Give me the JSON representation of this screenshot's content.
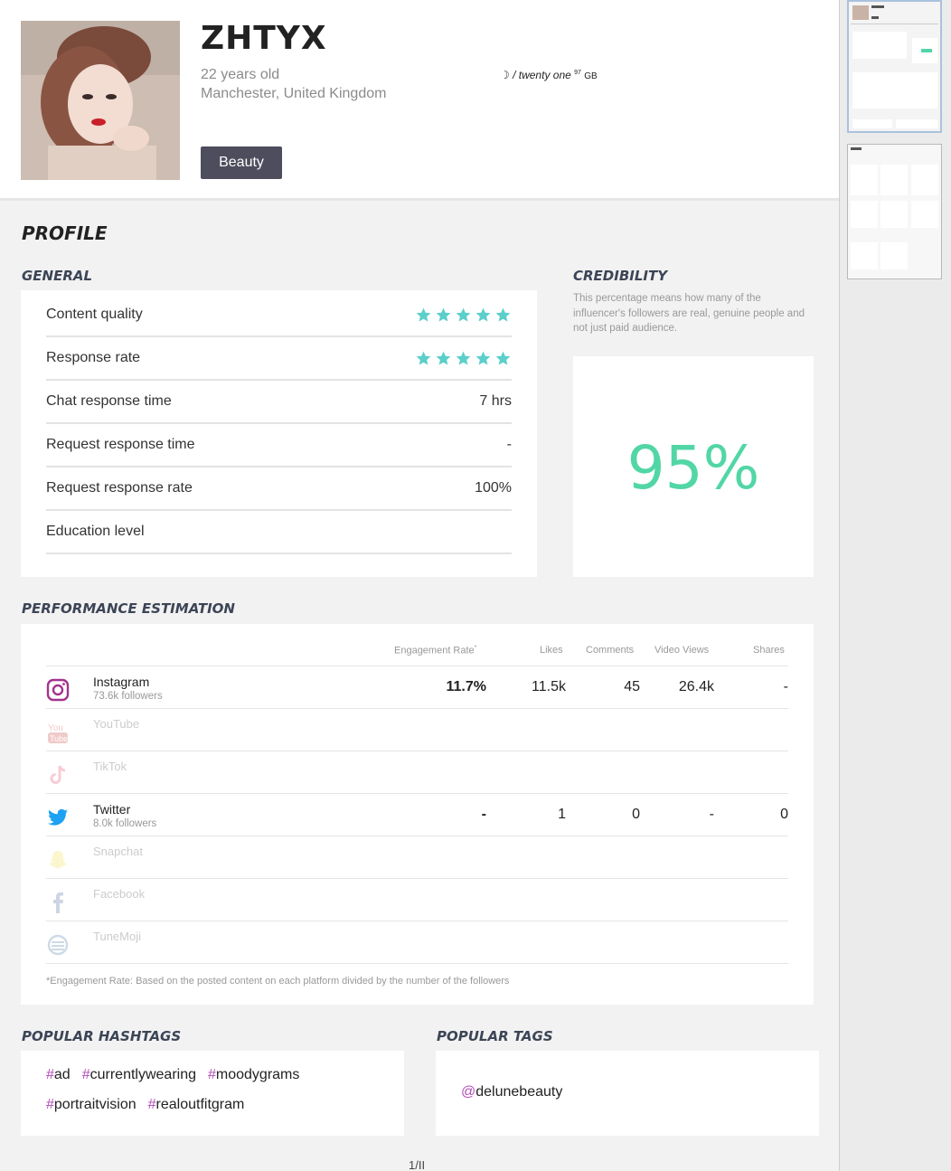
{
  "profile": {
    "name": "ZHTYX",
    "age": "22 years old",
    "location": "Manchester, United Kingdom",
    "source_brand": "☽ / twenty one",
    "source_sup": "97",
    "source_suffix": "GB",
    "category": "Beauty"
  },
  "sections": {
    "profile": "PROFILE",
    "general": "GENERAL",
    "credibility": "CREDIBILITY",
    "performance": "PERFORMANCE ESTIMATION",
    "hashtags": "POPULAR HASHTAGS",
    "tags": "POPULAR TAGS"
  },
  "general": [
    {
      "label": "Content quality",
      "stars": 5
    },
    {
      "label": "Response rate",
      "stars": 5
    },
    {
      "label": "Chat response time",
      "value": "7 hrs"
    },
    {
      "label": "Request response time",
      "value": "-"
    },
    {
      "label": "Request response rate",
      "value": "100%"
    },
    {
      "label": "Education level",
      "value": ""
    }
  ],
  "credibility": {
    "description": "This percentage means how many of the influencer's followers are real, genuine people and not just paid audience.",
    "value": "95%"
  },
  "performance": {
    "headers": {
      "engagement": "Engagement Rate",
      "engagement_mark": "*",
      "likes": "Likes",
      "comments": "Comments",
      "video_views": "Video Views",
      "shares": "Shares"
    },
    "platforms": [
      {
        "name": "Instagram",
        "followers": "73.6k followers",
        "engagement": "11.7%",
        "likes": "11.5k",
        "comments": "45",
        "views": "26.4k",
        "shares": "-"
      },
      {
        "name": "YouTube"
      },
      {
        "name": "TikTok"
      },
      {
        "name": "Twitter",
        "followers": "8.0k followers",
        "engagement": "-",
        "likes": "1",
        "comments": "0",
        "views": "-",
        "shares": "0"
      },
      {
        "name": "Snapchat"
      },
      {
        "name": "Facebook"
      },
      {
        "name": "TuneMoji"
      }
    ],
    "note": "*Engagement Rate: Based on the posted content on each platform divided by the number of the followers"
  },
  "hashtags": [
    "ad",
    "currentlywearing",
    "moodygrams",
    "portraitvision",
    "realoutfitgram"
  ],
  "tags": [
    "delunebeauty"
  ],
  "pager": "1/II",
  "colors": {
    "accent": "#5ccfcb",
    "credibility": "#52d6a6",
    "hash": "#b24bb8",
    "badge": "#4d4d5e"
  }
}
